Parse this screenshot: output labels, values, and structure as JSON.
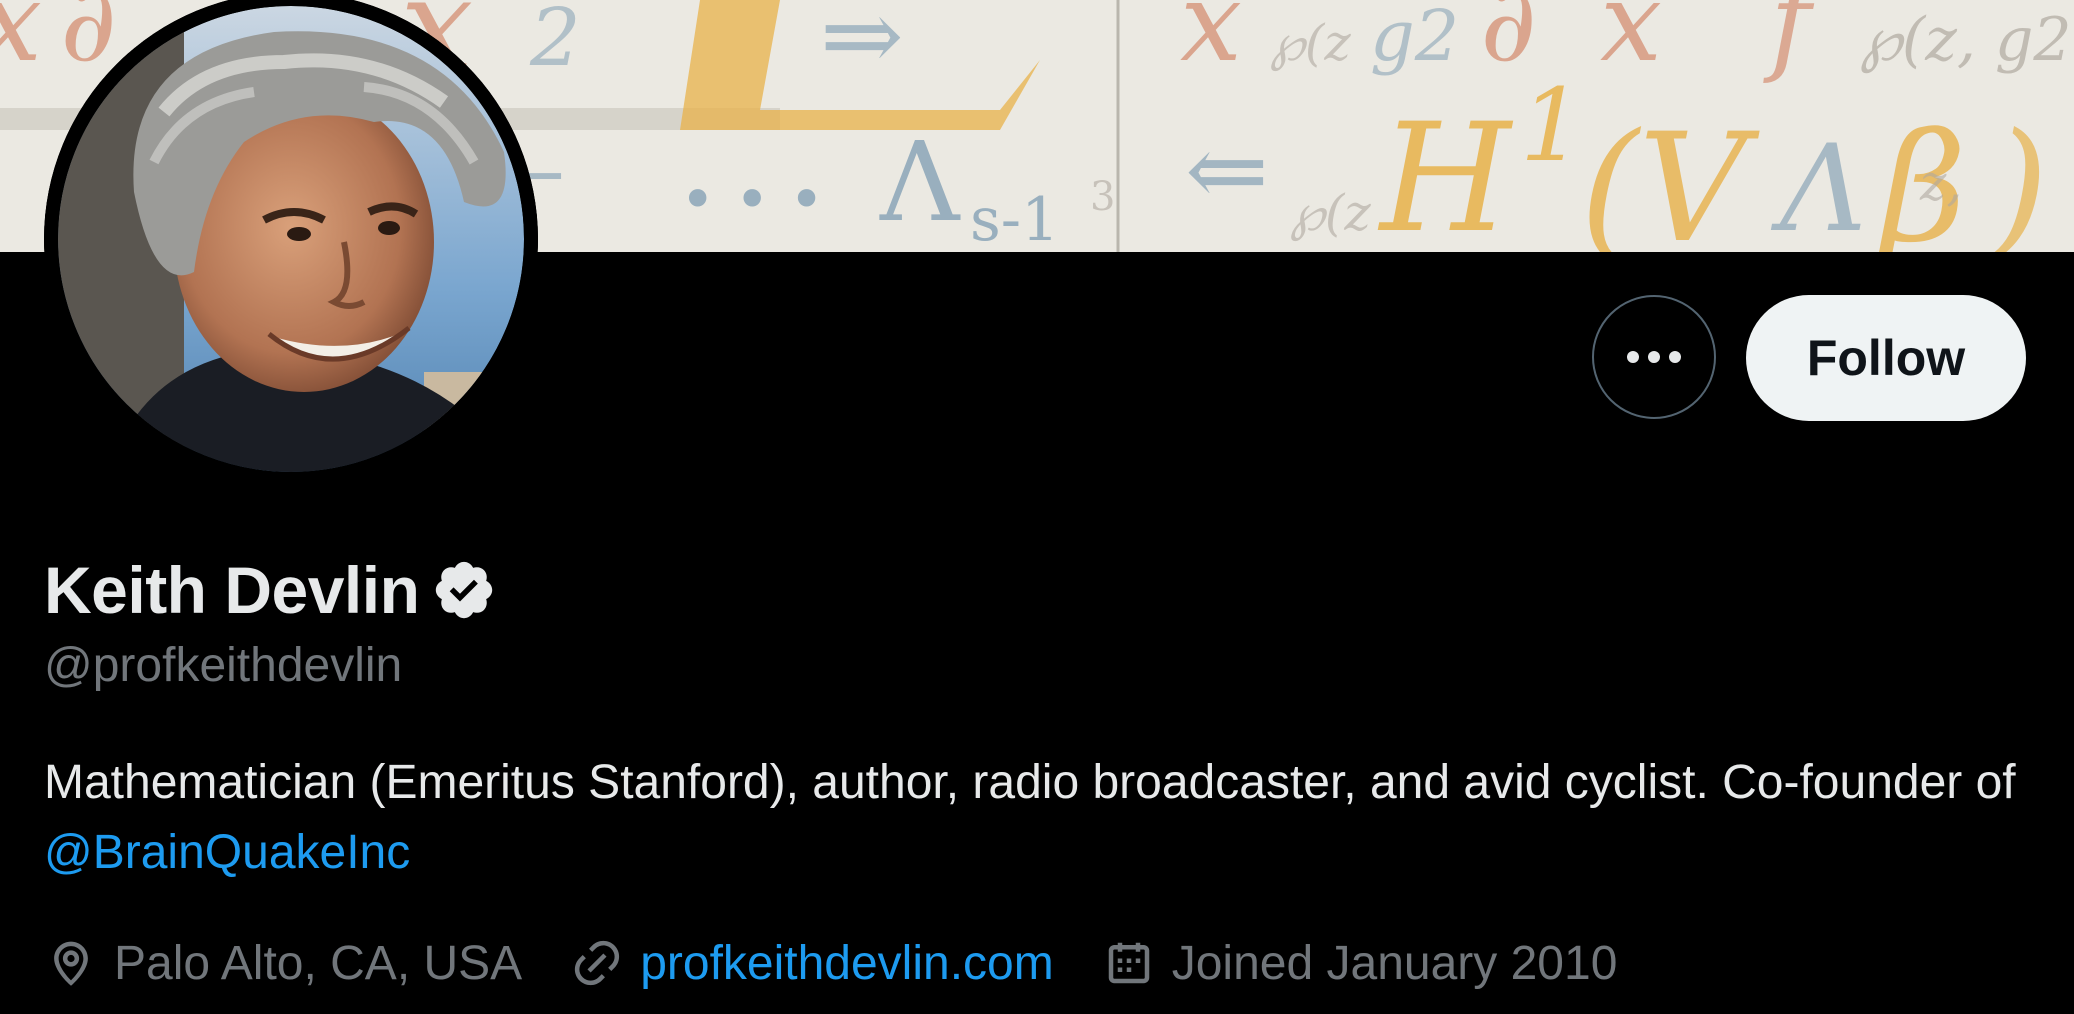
{
  "profile": {
    "display_name": "Keith Devlin",
    "handle": "@profkeithdevlin",
    "verified": true,
    "bio_text": "Mathematician (Emeritus Stanford), author, radio broadcaster, and avid cyclist. Co-founder of ",
    "bio_mention": "@BrainQuakeInc",
    "location": "Palo Alto, CA, USA",
    "website": "profkeithdevlin.com",
    "joined": "Joined January 2010"
  },
  "actions": {
    "follow_label": "Follow",
    "more_icon": "ellipsis-icon"
  },
  "icons": {
    "verified": "verified-badge-icon",
    "location": "location-pin-icon",
    "link": "link-icon",
    "calendar": "calendar-icon"
  },
  "colors": {
    "background": "#000000",
    "primary_text": "#e7e9ea",
    "secondary_text": "#71767b",
    "link": "#1d9bf0",
    "follow_button_bg": "#eff3f4",
    "follow_button_text": "#0f1419"
  }
}
